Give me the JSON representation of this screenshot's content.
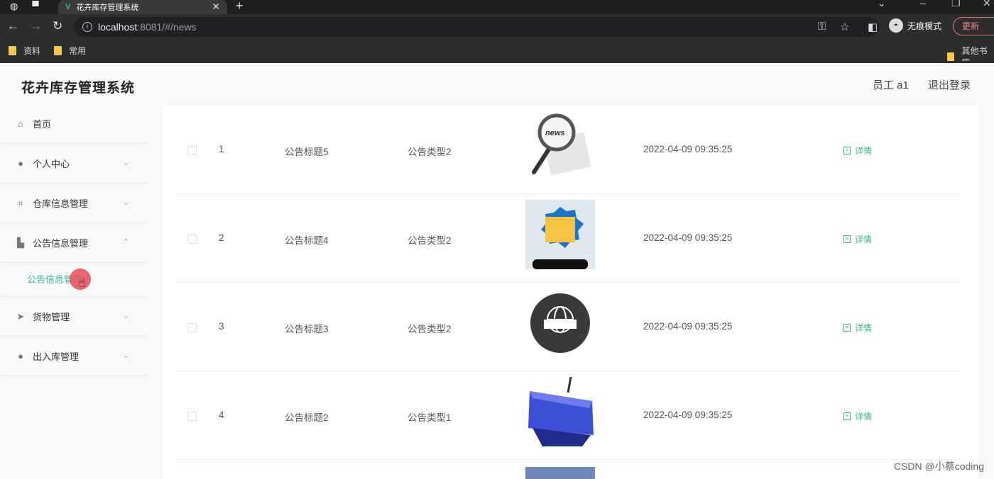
{
  "browser": {
    "tab_title": "花卉库存管理系统",
    "url_host": "localhost",
    "url_rest": ":8081/#/news",
    "incognito_label": "无痕模式",
    "update_label": "更新",
    "bookmarks": [
      "资料",
      "常用"
    ],
    "other_bookmarks": "其他书签"
  },
  "app": {
    "title": "花卉库存管理系统",
    "user": "员工 a1",
    "logout": "退出登录"
  },
  "sidebar": {
    "items": [
      {
        "label": "首页",
        "icon": "home-icon"
      },
      {
        "label": "个人中心",
        "icon": "user-icon"
      },
      {
        "label": "仓库信息管理",
        "icon": "crop-icon"
      },
      {
        "label": "公告信息管理",
        "icon": "bulletin-icon"
      },
      {
        "label": "货物管理",
        "icon": "send-icon"
      },
      {
        "label": "出入库管理",
        "icon": "user-icon"
      }
    ],
    "active_sub": "公告信息管理"
  },
  "table": {
    "rows": [
      {
        "index": "1",
        "title": "公告标题5",
        "type": "公告类型2",
        "image": "magnifier-news",
        "time": "2022-04-09 09:35:25",
        "action": "详情"
      },
      {
        "index": "2",
        "title": "公告标题4",
        "type": "公告类型2",
        "image": "breaking-news-phone",
        "time": "2022-04-09 09:35:25",
        "action": "详情"
      },
      {
        "index": "3",
        "title": "公告标题3",
        "type": "公告类型2",
        "image": "globe-news",
        "time": "2022-04-09 09:35:25",
        "action": "详情"
      },
      {
        "index": "4",
        "title": "公告标题2",
        "type": "公告类型1",
        "image": "news-key",
        "time": "2022-04-09 09:35:25",
        "action": "详情"
      }
    ]
  },
  "watermark": "CSDN @小蔡coding",
  "colors": {
    "accent": "#3bb77e",
    "active_menu": "#3bb7a0"
  }
}
